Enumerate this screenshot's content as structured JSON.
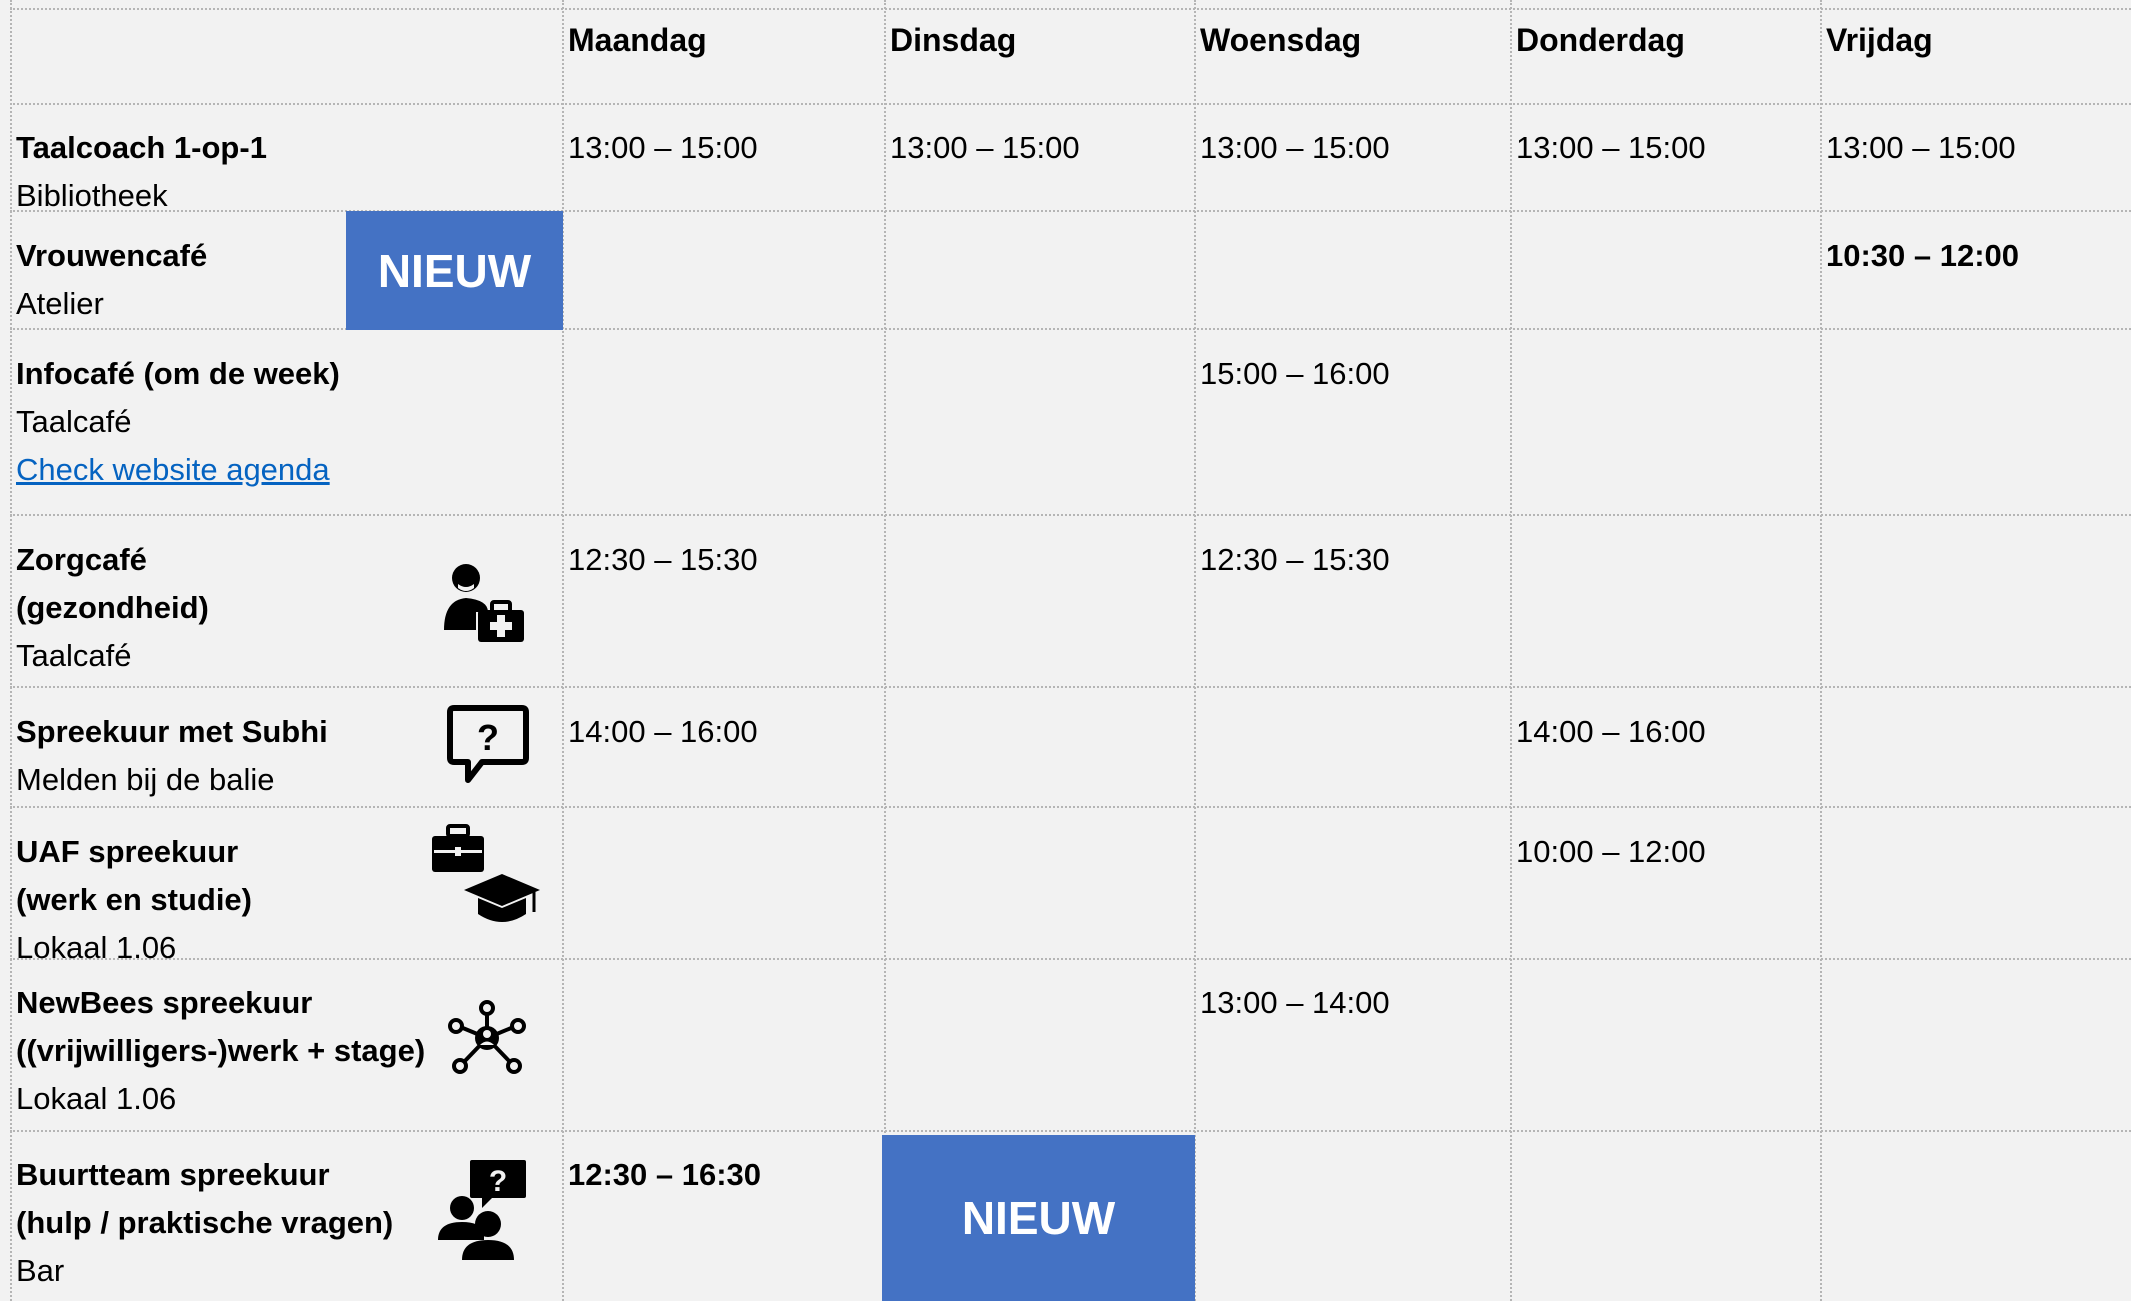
{
  "days": [
    "Maandag",
    "Dinsdag",
    "Woensdag",
    "Donderdag",
    "Vrijdag"
  ],
  "badge_label": "NIEUW",
  "rows": [
    {
      "title": "Taalcoach 1-op-1",
      "location": "Bibliotheek",
      "times": {
        "ma": "13:00 – 15:00",
        "di": "13:00 – 15:00",
        "wo": "13:00 – 15:00",
        "do": "13:00 – 15:00",
        "vr": "13:00 – 15:00"
      }
    },
    {
      "title": "Vrouwencafé",
      "location": "Atelier",
      "times": {
        "vr": "10:30 – 12:00"
      }
    },
    {
      "title": "Infocafé (om de week)",
      "location": "Taalcafé",
      "link": "Check website agenda",
      "times": {
        "wo": "15:00 – 16:00"
      }
    },
    {
      "title_lines": [
        "Zorgcafé",
        "(gezondheid)"
      ],
      "location": "Taalcafé",
      "icon": "doctor-medical-bag-icon",
      "times": {
        "ma": "12:30 – 15:30",
        "wo": "12:30 – 15:30"
      }
    },
    {
      "title": "Spreekuur met Subhi",
      "location": "Melden bij de balie",
      "icon": "question-speech-bubble-icon",
      "times": {
        "ma": "14:00 – 16:00",
        "do": "14:00 – 16:00"
      }
    },
    {
      "title_lines": [
        "UAF spreekuur",
        "(werk en studie)"
      ],
      "location": "Lokaal 1.06",
      "icons": [
        "briefcase-icon",
        "graduation-cap-icon"
      ],
      "times": {
        "do": "10:00 – 12:00"
      }
    },
    {
      "title_lines": [
        "NewBees spreekuur",
        "((vrijwilligers-)werk + stage)"
      ],
      "location": "Lokaal 1.06",
      "icon": "network-people-icon",
      "times": {
        "wo": "13:00 – 14:00"
      }
    },
    {
      "title_lines": [
        "Buurtteam spreekuur",
        "(hulp / praktische vragen)"
      ],
      "location": "Bar",
      "icon": "people-question-icon",
      "times": {
        "ma": "12:30 – 16:30"
      }
    }
  ]
}
